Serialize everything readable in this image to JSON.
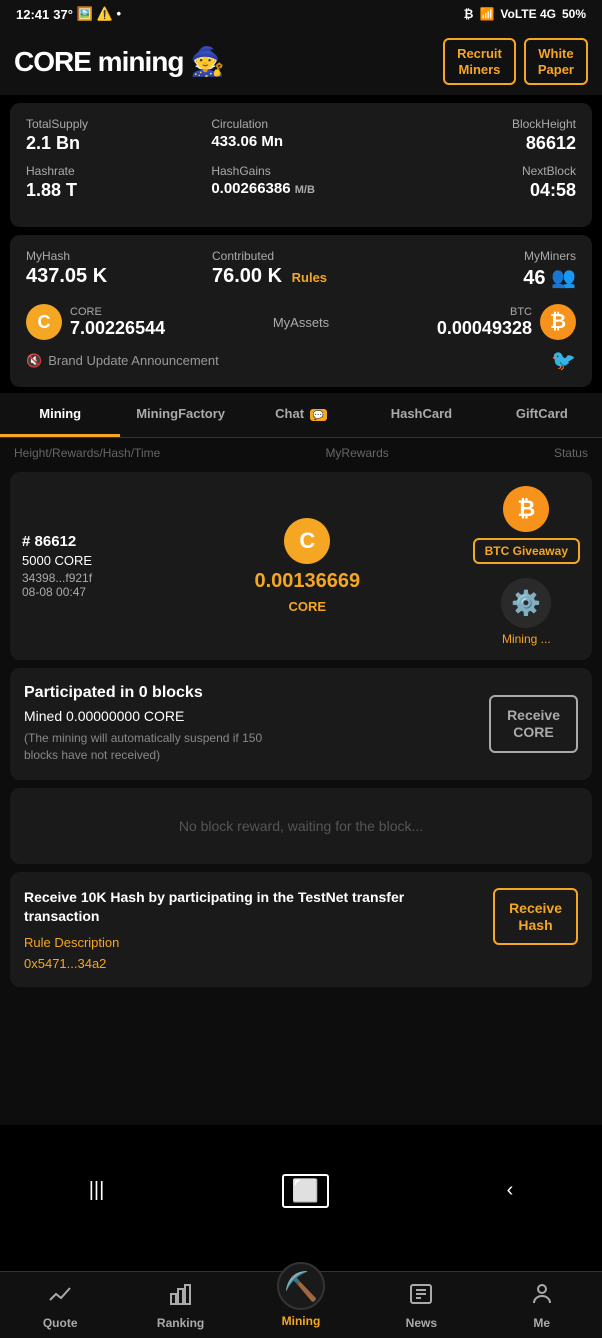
{
  "statusBar": {
    "time": "12:41",
    "temp": "37°",
    "battery": "50%"
  },
  "header": {
    "logo_core": "CORE",
    "logo_mining": "mining",
    "btn_recruit": "Recruit\nMiners",
    "btn_whitepaper": "White\nPaper"
  },
  "stats": {
    "totalSupply_label": "TotalSupply",
    "totalSupply_value": "2.1 Bn",
    "circulation_label": "Circulation",
    "circulation_value": "433.06 Mn",
    "blockHeight_label": "BlockHeight",
    "blockHeight_value": "86612",
    "hashrate_label": "Hashrate",
    "hashrate_value": "1.88 T",
    "hashGains_label": "HashGains",
    "hashGains_value": "0.00266386",
    "hashGains_unit": "M/B",
    "nextBlock_label": "NextBlock",
    "nextBlock_value": "04:58"
  },
  "myInfo": {
    "myHash_label": "MyHash",
    "myHash_value": "437.05 K",
    "contributed_label": "Contributed",
    "contributed_value": "76.00 K",
    "contributed_rules": "Rules",
    "myMiners_label": "MyMiners",
    "myMiners_value": "46",
    "myAssets_label": "MyAssets",
    "core_value": "7.00226544",
    "btc_value": "0.00049328"
  },
  "announcement": {
    "text": "Brand Update Announcement"
  },
  "tabs": [
    {
      "label": "Mining",
      "active": true,
      "badge": null
    },
    {
      "label": "MiningFactory",
      "active": false,
      "badge": null
    },
    {
      "label": "Chat",
      "active": false,
      "badge": "💬"
    },
    {
      "label": "HashCard",
      "active": false,
      "badge": null
    },
    {
      "label": "GiftCard",
      "active": false,
      "badge": null
    }
  ],
  "columnHeaders": {
    "left": "Height/Rewards/Hash/Time",
    "center": "MyRewards",
    "right": "Status"
  },
  "miningBlock": {
    "height": "# 86612",
    "rewards": "5000 CORE",
    "hash": "34398...f921f",
    "time": "08-08 00:47",
    "core_reward": "0.00136669",
    "core_label": "CORE",
    "btc_giveaway": "BTC Giveaway",
    "status": "Mining ..."
  },
  "participated": {
    "title": "Participated in 0 blocks",
    "mined": "Mined 0.00000000 CORE",
    "note": "(The mining will automatically suspend if 150 blocks have not received)",
    "btn": "Receive\nCORE"
  },
  "noReward": {
    "text": "No block reward, waiting for the block..."
  },
  "testnet": {
    "title": "Receive 10K Hash by participating in the TestNet transfer transaction",
    "rule_link": "Rule Description",
    "address": "0x5471...34a2",
    "btn": "Receive\nHash"
  },
  "bottomNav": [
    {
      "label": "Quote",
      "icon": "📈",
      "active": false
    },
    {
      "label": "Ranking",
      "icon": "📊",
      "active": false
    },
    {
      "label": "Mining",
      "icon": "⛏️",
      "active": true
    },
    {
      "label": "News",
      "icon": "📋",
      "active": false
    },
    {
      "label": "Me",
      "icon": "👤",
      "active": false
    }
  ]
}
